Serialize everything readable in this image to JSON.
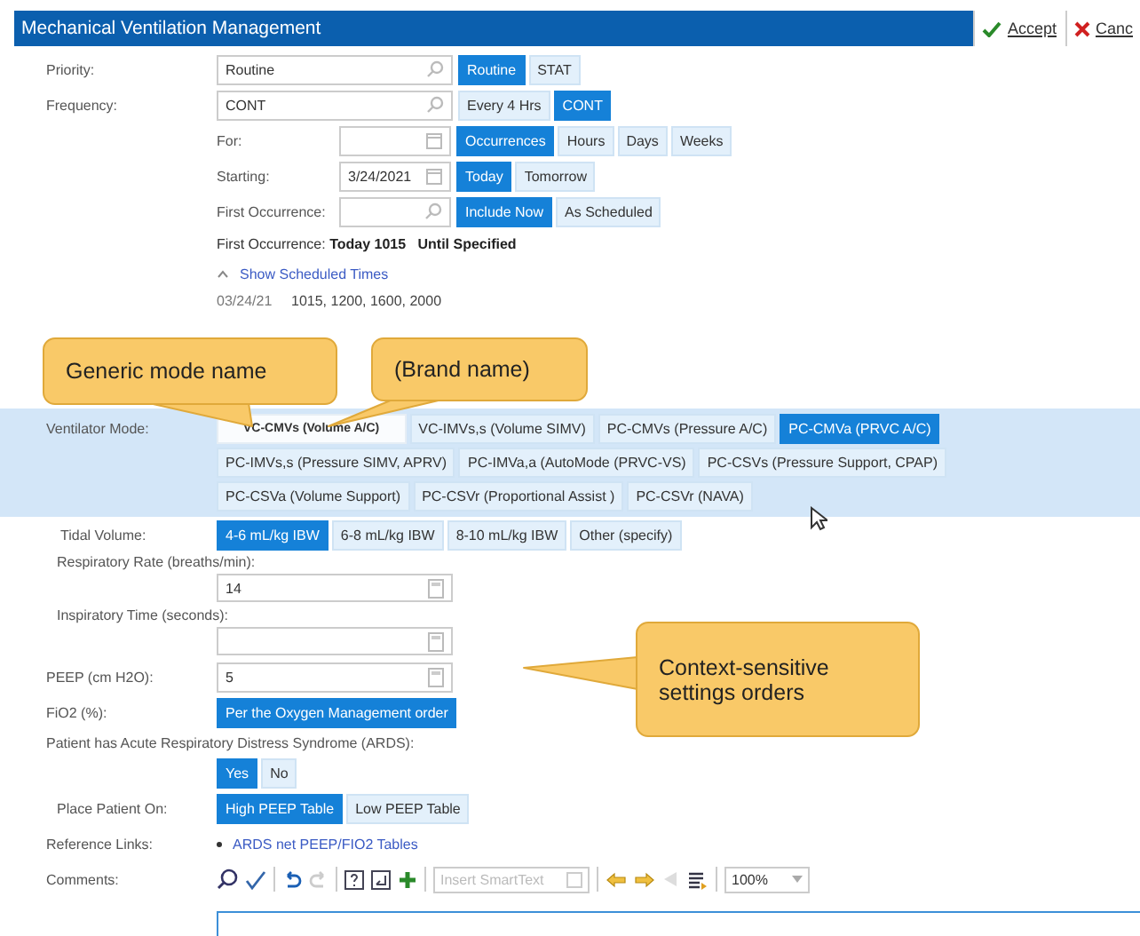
{
  "title": "Mechanical Ventilation Management",
  "header_actions": [
    {
      "label": "Accept",
      "kind": "accept"
    },
    {
      "label": "Canc",
      "kind": "cancel"
    }
  ],
  "priority": {
    "label": "Priority:",
    "value": "Routine",
    "options": [
      {
        "label": "Routine",
        "selected": true
      },
      {
        "label": "STAT",
        "selected": false
      }
    ]
  },
  "frequency": {
    "label": "Frequency:",
    "value": "CONT",
    "options": [
      {
        "label": "Every 4 Hrs",
        "selected": false
      },
      {
        "label": "CONT",
        "selected": true
      }
    ]
  },
  "for": {
    "label": "For:",
    "options": [
      {
        "label": "Occurrences",
        "selected": true
      },
      {
        "label": "Hours",
        "selected": false
      },
      {
        "label": "Days",
        "selected": false
      },
      {
        "label": "Weeks",
        "selected": false
      }
    ]
  },
  "starting": {
    "label": "Starting:",
    "value": "3/24/2021",
    "options": [
      {
        "label": "Today",
        "selected": true
      },
      {
        "label": "Tomorrow",
        "selected": false
      }
    ]
  },
  "first_occurrence": {
    "label": "First Occurrence:",
    "options": [
      {
        "label": "Include Now",
        "selected": true
      },
      {
        "label": "As Scheduled",
        "selected": false
      }
    ]
  },
  "first_occurrence_summary": {
    "label": "First Occurrence:",
    "value": "Today 1015",
    "until": "Until Specified"
  },
  "schedule": {
    "toggle": "Show Scheduled Times",
    "expanded": true,
    "rows": [
      {
        "date": "03/24/21",
        "times": "1015, 1200, 1600, 2000"
      }
    ]
  },
  "ventilator_mode": {
    "label": "Ventilator Mode:",
    "options": [
      {
        "label": "VC-CMVs (Volume A/C)",
        "selected": false,
        "focused": true
      },
      {
        "label": "VC-IMVs,s (Volume SIMV)",
        "selected": false
      },
      {
        "label": "PC-CMVs (Pressure A/C)",
        "selected": false
      },
      {
        "label": "PC-CMVa (PRVC A/C)",
        "selected": true
      },
      {
        "label": "PC-IMVs,s (Pressure SIMV, APRV)",
        "selected": false
      },
      {
        "label": "PC-IMVa,a (AutoMode (PRVC-VS)",
        "selected": false
      },
      {
        "label": "PC-CSVs (Pressure Support, CPAP)",
        "selected": false
      },
      {
        "label": "PC-CSVa (Volume Support)",
        "selected": false
      },
      {
        "label": "PC-CSVr (Proportional Assist )",
        "selected": false
      },
      {
        "label": "PC-CSVr (NAVA)",
        "selected": false
      }
    ]
  },
  "tidal_volume": {
    "label": "Tidal Volume:",
    "options": [
      {
        "label": "4-6 mL/kg IBW",
        "selected": true
      },
      {
        "label": "6-8 mL/kg IBW",
        "selected": false
      },
      {
        "label": "8-10 mL/kg IBW",
        "selected": false
      },
      {
        "label": "Other (specify)",
        "selected": false
      }
    ]
  },
  "respiratory_rate": {
    "label": "Respiratory Rate (breaths/min):",
    "value": "14"
  },
  "inspiratory_time": {
    "label": "Inspiratory Time (seconds):"
  },
  "peep": {
    "label": "PEEP (cm H2O):",
    "value": "5"
  },
  "fio2": {
    "label": "FiO2 (%):",
    "options": [
      {
        "label": "Per the Oxygen Management order",
        "selected": true
      }
    ]
  },
  "ards": {
    "label": "Patient has Acute Respiratory Distress Syndrome (ARDS):",
    "options": [
      {
        "label": "Yes",
        "selected": true
      },
      {
        "label": "No",
        "selected": false
      }
    ]
  },
  "place_patient_on": {
    "label": "Place Patient On:",
    "options": [
      {
        "label": "High PEEP Table",
        "selected": true
      },
      {
        "label": "Low PEEP Table",
        "selected": false
      }
    ]
  },
  "reference_links": {
    "label": "Reference Links:",
    "links": [
      "ARDS net PEEP/FIO2 Tables"
    ]
  },
  "comments": {
    "label": "Comments:",
    "smarttext_placeholder": "Insert SmartText",
    "zoom": "100%"
  },
  "callouts": [
    {
      "text": "Generic mode name"
    },
    {
      "text": "(Brand name)"
    },
    {
      "text": "Context-sensitive settings orders"
    }
  ]
}
